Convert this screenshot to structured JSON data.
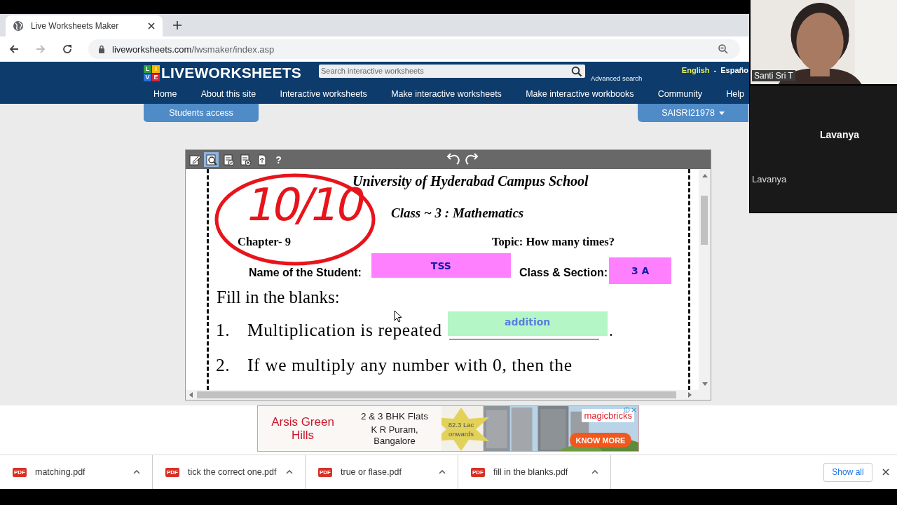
{
  "browser": {
    "tabs": [
      {
        "title": "Live Worksheets Maker",
        "selected": true
      }
    ],
    "url_host": "liveworksheets.com",
    "url_path": "/lwsmaker/index.asp"
  },
  "site": {
    "logo_tiles": [
      {
        "letter": "L",
        "color": "#2e9e3e"
      },
      {
        "letter": "I",
        "color": "#f2b705"
      },
      {
        "letter": "V",
        "color": "#2a6fd6"
      },
      {
        "letter": "E",
        "color": "#d6243a"
      }
    ],
    "logo": "LIVEWORKSHEETS",
    "search": {
      "placeholder": "Search interactive worksheets"
    },
    "advanced_search": "Advanced search",
    "languages": [
      {
        "label": "English",
        "selected": true
      },
      {
        "label": "Españo",
        "selected": false
      }
    ],
    "language_separator": "-",
    "nav": [
      "Home",
      "About this site",
      "Interactive worksheets",
      "Make interactive worksheets",
      "Make interactive workbooks",
      "Community",
      "Help"
    ],
    "students_access": "Students access",
    "user": "SAISRI21978"
  },
  "worksheet": {
    "tools": [
      {
        "kind": "edit",
        "selected": false
      },
      {
        "kind": "preview",
        "selected": true
      },
      {
        "kind": "check",
        "selected": false
      },
      {
        "kind": "clear",
        "selected": false
      },
      {
        "kind": "export",
        "selected": false
      },
      {
        "kind": "help",
        "label": "?",
        "selected": false
      }
    ],
    "title": "University of Hyderabad Campus School",
    "subtitle": "Class ~ 3 : Mathematics",
    "grade": "10/10",
    "chapter": "Chapter- 9",
    "topic": "Topic: How many times?",
    "student_label": "Name of the Student:",
    "student_value": "TSS",
    "class_label": "Class & Section:",
    "class_value": "3 A",
    "heading": "Fill in the blanks:",
    "questions": [
      {
        "number": "1.",
        "text": "Multiplication is repeated",
        "answer": "addition",
        "end": "."
      },
      {
        "number": "2.",
        "text": "If we multiply any number with 0, then the"
      }
    ]
  },
  "ad": {
    "name": "Arsis Green Hills",
    "headline": "2 & 3 BHK Flats",
    "location": "K R Puram, Bangalore",
    "price": "82.3 Lac onwards",
    "brand": "magicbricks",
    "cta": "KNOW MORE"
  },
  "downloads": {
    "items": [
      {
        "name": "matching.pdf",
        "badge": "PDF"
      },
      {
        "name": "tick the correct one.pdf",
        "badge": "PDF"
      },
      {
        "name": "true or flase.pdf",
        "badge": "PDF"
      },
      {
        "name": "fill in the blanks.pdf",
        "badge": "PDF"
      }
    ],
    "show_all": "Show all"
  },
  "call": {
    "speaker": "Santi Sri T",
    "participant_center": "Lavanya",
    "participant_label": "Lavanya"
  }
}
